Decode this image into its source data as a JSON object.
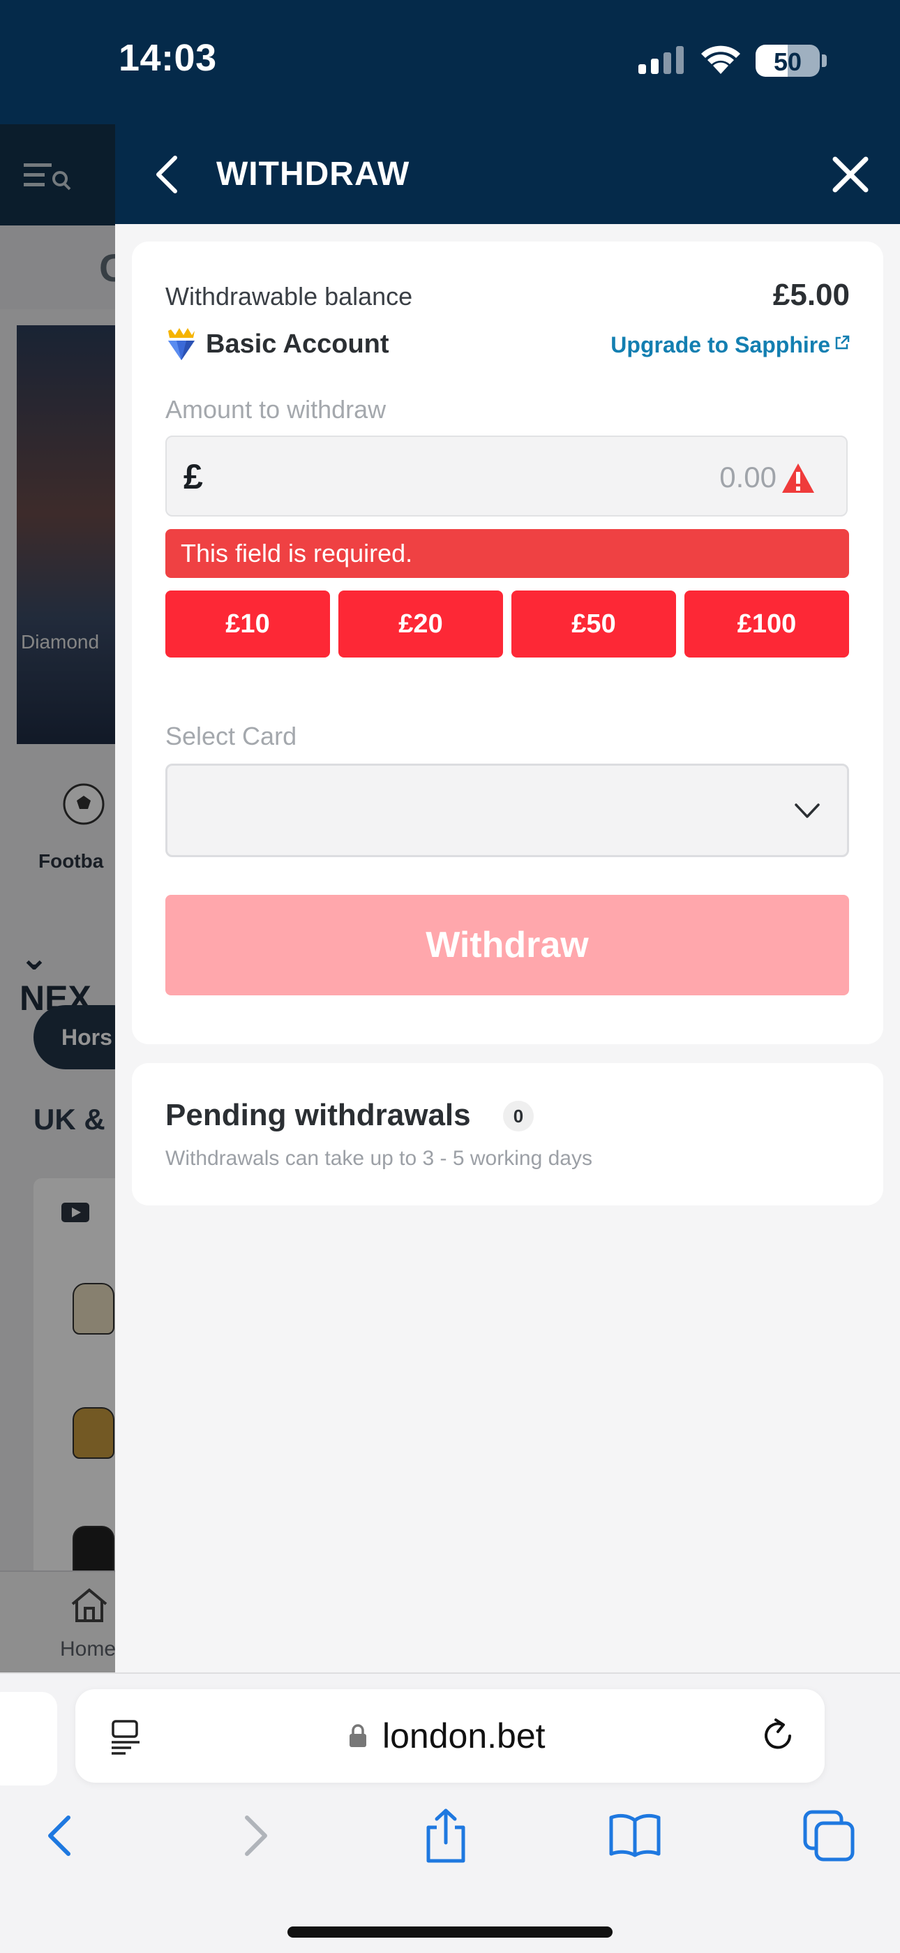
{
  "status_bar": {
    "time": "14:03",
    "battery": "50",
    "battery_level": 0.5
  },
  "background_app": {
    "header_letter": "G",
    "banner_text": "Diamond",
    "sport_label": "Footba",
    "section_title": "NEX",
    "pill_label": "Hors",
    "region_title": "UK &",
    "home_label": "Home"
  },
  "header": {
    "title": "WITHDRAW"
  },
  "balance": {
    "label": "Withdrawable balance",
    "value": "£5.00",
    "account_name": "Basic Account",
    "upgrade_link": "Upgrade to Sapphire"
  },
  "amount": {
    "label": "Amount to withdraw",
    "currency_symbol": "£",
    "placeholder": "0.00",
    "error": "This field is required.",
    "quick_options": [
      "£10",
      "£20",
      "£50",
      "£100"
    ]
  },
  "card": {
    "label": "Select Card",
    "selected": ""
  },
  "withdraw_button": "Withdraw",
  "pending": {
    "title": "Pending withdrawals",
    "count": "0",
    "note": "Withdrawals can take up to 3 - 5 working days"
  },
  "browser": {
    "url": "london.bet"
  },
  "colors": {
    "header": "#052a4a",
    "accent_red": "#fd2836",
    "error_red": "#ef4143",
    "disabled_button": "#ffa7ac",
    "link_blue": "#137fb1"
  }
}
